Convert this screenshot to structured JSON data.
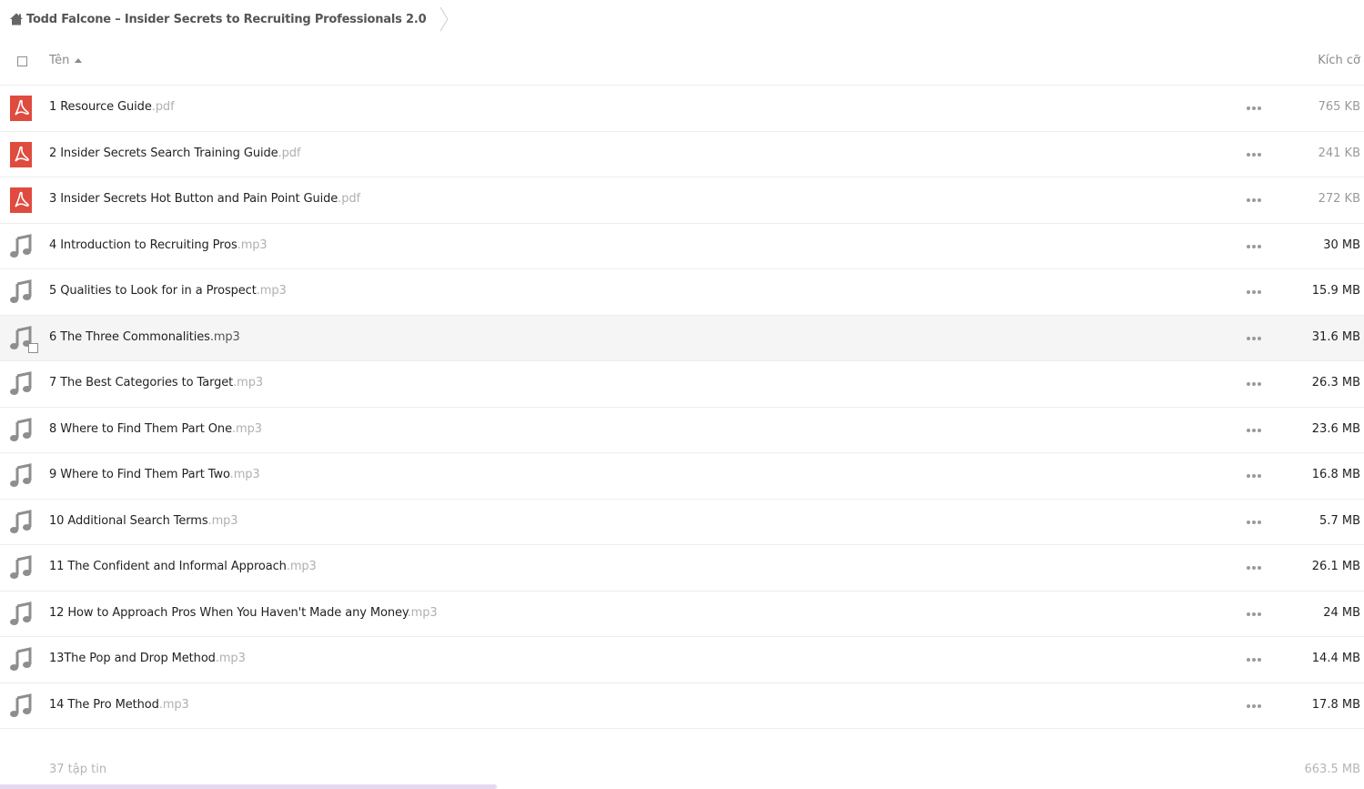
{
  "breadcrumb": {
    "folder_title": "Todd Falcone – Insider Secrets to Recruiting Professionals 2.0",
    "home_icon": "home-icon",
    "separator_icon": "chevron-right-icon"
  },
  "header": {
    "name_label": "Tên",
    "size_label": "Kích cỡ",
    "sort_direction": "ascending"
  },
  "files": [
    {
      "name": "1 Resource Guide",
      "ext": ".pdf",
      "size": "765 KB",
      "type": "pdf",
      "size_dark": false
    },
    {
      "name": "2 Insider Secrets Search Training Guide",
      "ext": ".pdf",
      "size": "241 KB",
      "type": "pdf",
      "size_dark": false
    },
    {
      "name": "3 Insider Secrets Hot Button and Pain Point Guide",
      "ext": ".pdf",
      "size": "272 KB",
      "type": "pdf",
      "size_dark": false
    },
    {
      "name": "4 Introduction to Recruiting Pros",
      "ext": ".mp3",
      "size": "30 MB",
      "type": "audio",
      "size_dark": true
    },
    {
      "name": "5 Qualities to Look for in a Prospect",
      "ext": ".mp3",
      "size": "15.9 MB",
      "type": "audio",
      "size_dark": true
    },
    {
      "name": "6 The Three Commonalities",
      "ext": ".mp3",
      "size": "31.6 MB",
      "type": "audio",
      "size_dark": true,
      "hovered": true
    },
    {
      "name": "7 The Best Categories to Target",
      "ext": ".mp3",
      "size": "26.3 MB",
      "type": "audio",
      "size_dark": true
    },
    {
      "name": "8 Where to Find Them Part One",
      "ext": ".mp3",
      "size": "23.6 MB",
      "type": "audio",
      "size_dark": true
    },
    {
      "name": "9 Where to Find Them Part Two",
      "ext": ".mp3",
      "size": "16.8 MB",
      "type": "audio",
      "size_dark": true
    },
    {
      "name": "10 Additional Search Terms",
      "ext": ".mp3",
      "size": "5.7 MB",
      "type": "audio",
      "size_dark": true
    },
    {
      "name": "11 The Confident and Informal Approach",
      "ext": ".mp3",
      "size": "26.1 MB",
      "type": "audio",
      "size_dark": true
    },
    {
      "name": "12 How to Approach Pros When You Haven't Made any Money",
      "ext": ".mp3",
      "size": "24 MB",
      "type": "audio",
      "size_dark": true
    },
    {
      "name": "13The Pop and Drop Method",
      "ext": ".mp3",
      "size": "14.4 MB",
      "type": "audio",
      "size_dark": true
    },
    {
      "name": "14 The Pro Method",
      "ext": ".mp3",
      "size": "17.8 MB",
      "type": "audio",
      "size_dark": true
    }
  ],
  "summary": {
    "count": "37 tập tin",
    "total_size": "663.5 MB"
  },
  "colors": {
    "pdf_icon": "#e04b3f",
    "audio_icon": "#8e8e8e",
    "row_hover": "#f5f5f5",
    "scrollbar": "#e4d9ef"
  }
}
